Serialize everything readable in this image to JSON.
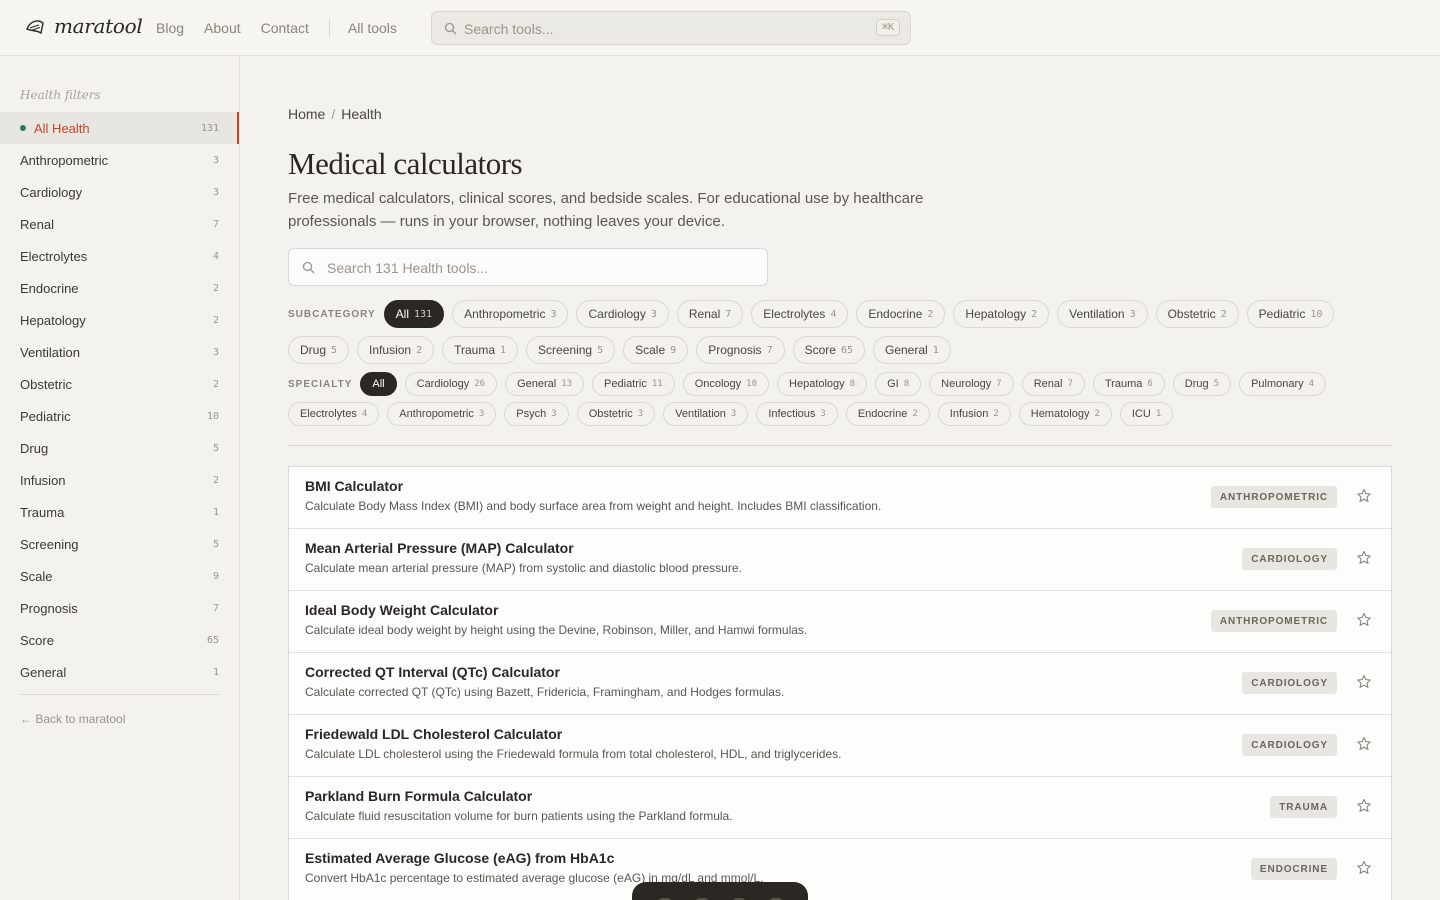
{
  "header": {
    "brand": "maratool",
    "nav": [
      "Blog",
      "About",
      "Contact"
    ],
    "all_tools": "All tools",
    "search_placeholder": "Search tools...",
    "search_shortcut": "⌘K"
  },
  "sidebar": {
    "heading": "Health filters",
    "items": [
      {
        "label": "All Health",
        "count": "131",
        "active": true
      },
      {
        "label": "Anthropometric",
        "count": "3"
      },
      {
        "label": "Cardiology",
        "count": "3"
      },
      {
        "label": "Renal",
        "count": "7"
      },
      {
        "label": "Electrolytes",
        "count": "4"
      },
      {
        "label": "Endocrine",
        "count": "2"
      },
      {
        "label": "Hepatology",
        "count": "2"
      },
      {
        "label": "Ventilation",
        "count": "3"
      },
      {
        "label": "Obstetric",
        "count": "2"
      },
      {
        "label": "Pediatric",
        "count": "10"
      },
      {
        "label": "Drug",
        "count": "5"
      },
      {
        "label": "Infusion",
        "count": "2"
      },
      {
        "label": "Trauma",
        "count": "1"
      },
      {
        "label": "Screening",
        "count": "5"
      },
      {
        "label": "Scale",
        "count": "9"
      },
      {
        "label": "Prognosis",
        "count": "7"
      },
      {
        "label": "Score",
        "count": "65"
      },
      {
        "label": "General",
        "count": "1"
      }
    ],
    "back_link": "← Back to maratool"
  },
  "main": {
    "breadcrumb": [
      "Home",
      "Health"
    ],
    "title": "Medical calculators",
    "description": "Free medical calculators, clinical scores, and bedside scales. For educational use by healthcare professionals — runs in your browser, nothing leaves your device.",
    "search_placeholder": "Search 131 Health tools...",
    "subcategory_label": "SUBCATEGORY",
    "subcategory_row1": [
      {
        "label": "All",
        "count": "131",
        "active": true
      },
      {
        "label": "Anthropometric",
        "count": "3"
      },
      {
        "label": "Cardiology",
        "count": "3"
      },
      {
        "label": "Renal",
        "count": "7"
      },
      {
        "label": "Electrolytes",
        "count": "4"
      },
      {
        "label": "Endocrine",
        "count": "2"
      },
      {
        "label": "Hepatology",
        "count": "2"
      },
      {
        "label": "Ventilation",
        "count": "3"
      },
      {
        "label": "Obstetric",
        "count": "2"
      },
      {
        "label": "Pediatric",
        "count": "10"
      }
    ],
    "subcategory_row2": [
      {
        "label": "Drug",
        "count": "5"
      },
      {
        "label": "Infusion",
        "count": "2"
      },
      {
        "label": "Trauma",
        "count": "1"
      },
      {
        "label": "Screening",
        "count": "5"
      },
      {
        "label": "Scale",
        "count": "9"
      },
      {
        "label": "Prognosis",
        "count": "7"
      },
      {
        "label": "Score",
        "count": "65"
      },
      {
        "label": "General",
        "count": "1"
      }
    ],
    "specialty_label": "SPECIALTY",
    "specialty_row1": [
      {
        "label": "All",
        "count": "",
        "active": true
      },
      {
        "label": "Cardiology",
        "count": "26"
      },
      {
        "label": "General",
        "count": "13"
      },
      {
        "label": "Pediatric",
        "count": "11"
      },
      {
        "label": "Oncology",
        "count": "10"
      },
      {
        "label": "Hepatology",
        "count": "8"
      },
      {
        "label": "GI",
        "count": "8"
      },
      {
        "label": "Neurology",
        "count": "7"
      },
      {
        "label": "Renal",
        "count": "7"
      },
      {
        "label": "Trauma",
        "count": "6"
      },
      {
        "label": "Drug",
        "count": "5"
      },
      {
        "label": "Pulmonary",
        "count": "4"
      }
    ],
    "specialty_row2": [
      {
        "label": "Electrolytes",
        "count": "4"
      },
      {
        "label": "Anthropometric",
        "count": "3"
      },
      {
        "label": "Psych",
        "count": "3"
      },
      {
        "label": "Obstetric",
        "count": "3"
      },
      {
        "label": "Ventilation",
        "count": "3"
      },
      {
        "label": "Infectious",
        "count": "3"
      },
      {
        "label": "Endocrine",
        "count": "2"
      },
      {
        "label": "Infusion",
        "count": "2"
      },
      {
        "label": "Hematology",
        "count": "2"
      },
      {
        "label": "ICU",
        "count": "1"
      }
    ],
    "tools": [
      {
        "title": "BMI Calculator",
        "desc": "Calculate Body Mass Index (BMI) and body surface area from weight and height. Includes BMI classification.",
        "tag": "ANTHROPOMETRIC"
      },
      {
        "title": "Mean Arterial Pressure (MAP) Calculator",
        "desc": "Calculate mean arterial pressure (MAP) from systolic and diastolic blood pressure.",
        "tag": "CARDIOLOGY"
      },
      {
        "title": "Ideal Body Weight Calculator",
        "desc": "Calculate ideal body weight by height using the Devine, Robinson, Miller, and Hamwi formulas.",
        "tag": "ANTHROPOMETRIC"
      },
      {
        "title": "Corrected QT Interval (QTc) Calculator",
        "desc": "Calculate corrected QT (QTc) using Bazett, Fridericia, Framingham, and Hodges formulas.",
        "tag": "CARDIOLOGY"
      },
      {
        "title": "Friedewald LDL Cholesterol Calculator",
        "desc": "Calculate LDL cholesterol using the Friedewald formula from total cholesterol, HDL, and triglycerides.",
        "tag": "CARDIOLOGY"
      },
      {
        "title": "Parkland Burn Formula Calculator",
        "desc": "Calculate fluid resuscitation volume for burn patients using the Parkland formula.",
        "tag": "TRAUMA"
      },
      {
        "title": "Estimated Average Glucose (eAG) from HbA1c",
        "desc": "Convert HbA1c percentage to estimated average glucose (eAG) in mg/dL and mmol/L.",
        "tag": "ENDOCRINE"
      }
    ]
  }
}
